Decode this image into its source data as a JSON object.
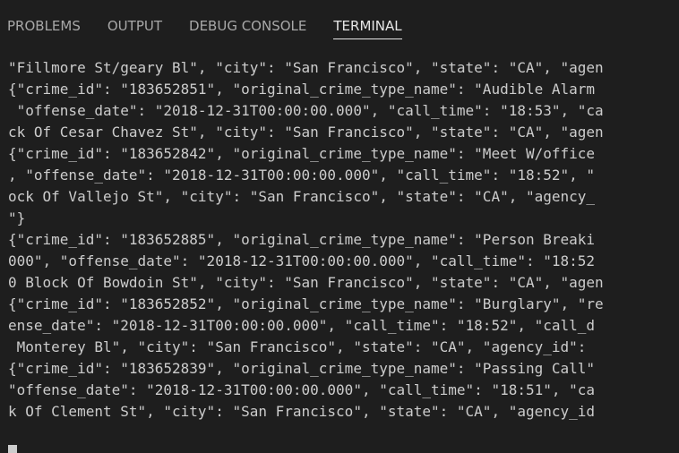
{
  "tabs": [
    {
      "label": "PROBLEMS",
      "active": false
    },
    {
      "label": "OUTPUT",
      "active": false
    },
    {
      "label": "DEBUG CONSOLE",
      "active": false
    },
    {
      "label": "TERMINAL",
      "active": true
    }
  ],
  "terminal": {
    "lines": [
      "\"Fillmore St/geary Bl\", \"city\": \"San Francisco\", \"state\": \"CA\", \"agen",
      "{\"crime_id\": \"183652851\", \"original_crime_type_name\": \"Audible Alarm",
      " \"offense_date\": \"2018-12-31T00:00:00.000\", \"call_time\": \"18:53\", \"ca",
      "ck Of Cesar Chavez St\", \"city\": \"San Francisco\", \"state\": \"CA\", \"agen",
      "{\"crime_id\": \"183652842\", \"original_crime_type_name\": \"Meet W/office",
      ", \"offense_date\": \"2018-12-31T00:00:00.000\", \"call_time\": \"18:52\", \"",
      "ock Of Vallejo St\", \"city\": \"San Francisco\", \"state\": \"CA\", \"agency_",
      "\"}",
      "{\"crime_id\": \"183652885\", \"original_crime_type_name\": \"Person Breaki",
      "000\", \"offense_date\": \"2018-12-31T00:00:00.000\", \"call_time\": \"18:52",
      "0 Block Of Bowdoin St\", \"city\": \"San Francisco\", \"state\": \"CA\", \"agen",
      "{\"crime_id\": \"183652852\", \"original_crime_type_name\": \"Burglary\", \"re",
      "ense_date\": \"2018-12-31T00:00:00.000\", \"call_time\": \"18:52\", \"call_d",
      " Monterey Bl\", \"city\": \"San Francisco\", \"state\": \"CA\", \"agency_id\": ",
      "{\"crime_id\": \"183652839\", \"original_crime_type_name\": \"Passing Call\"",
      "\"offense_date\": \"2018-12-31T00:00:00.000\", \"call_time\": \"18:51\", \"ca",
      "k Of Clement St\", \"city\": \"San Francisco\", \"state\": \"CA\", \"agency_id"
    ]
  }
}
